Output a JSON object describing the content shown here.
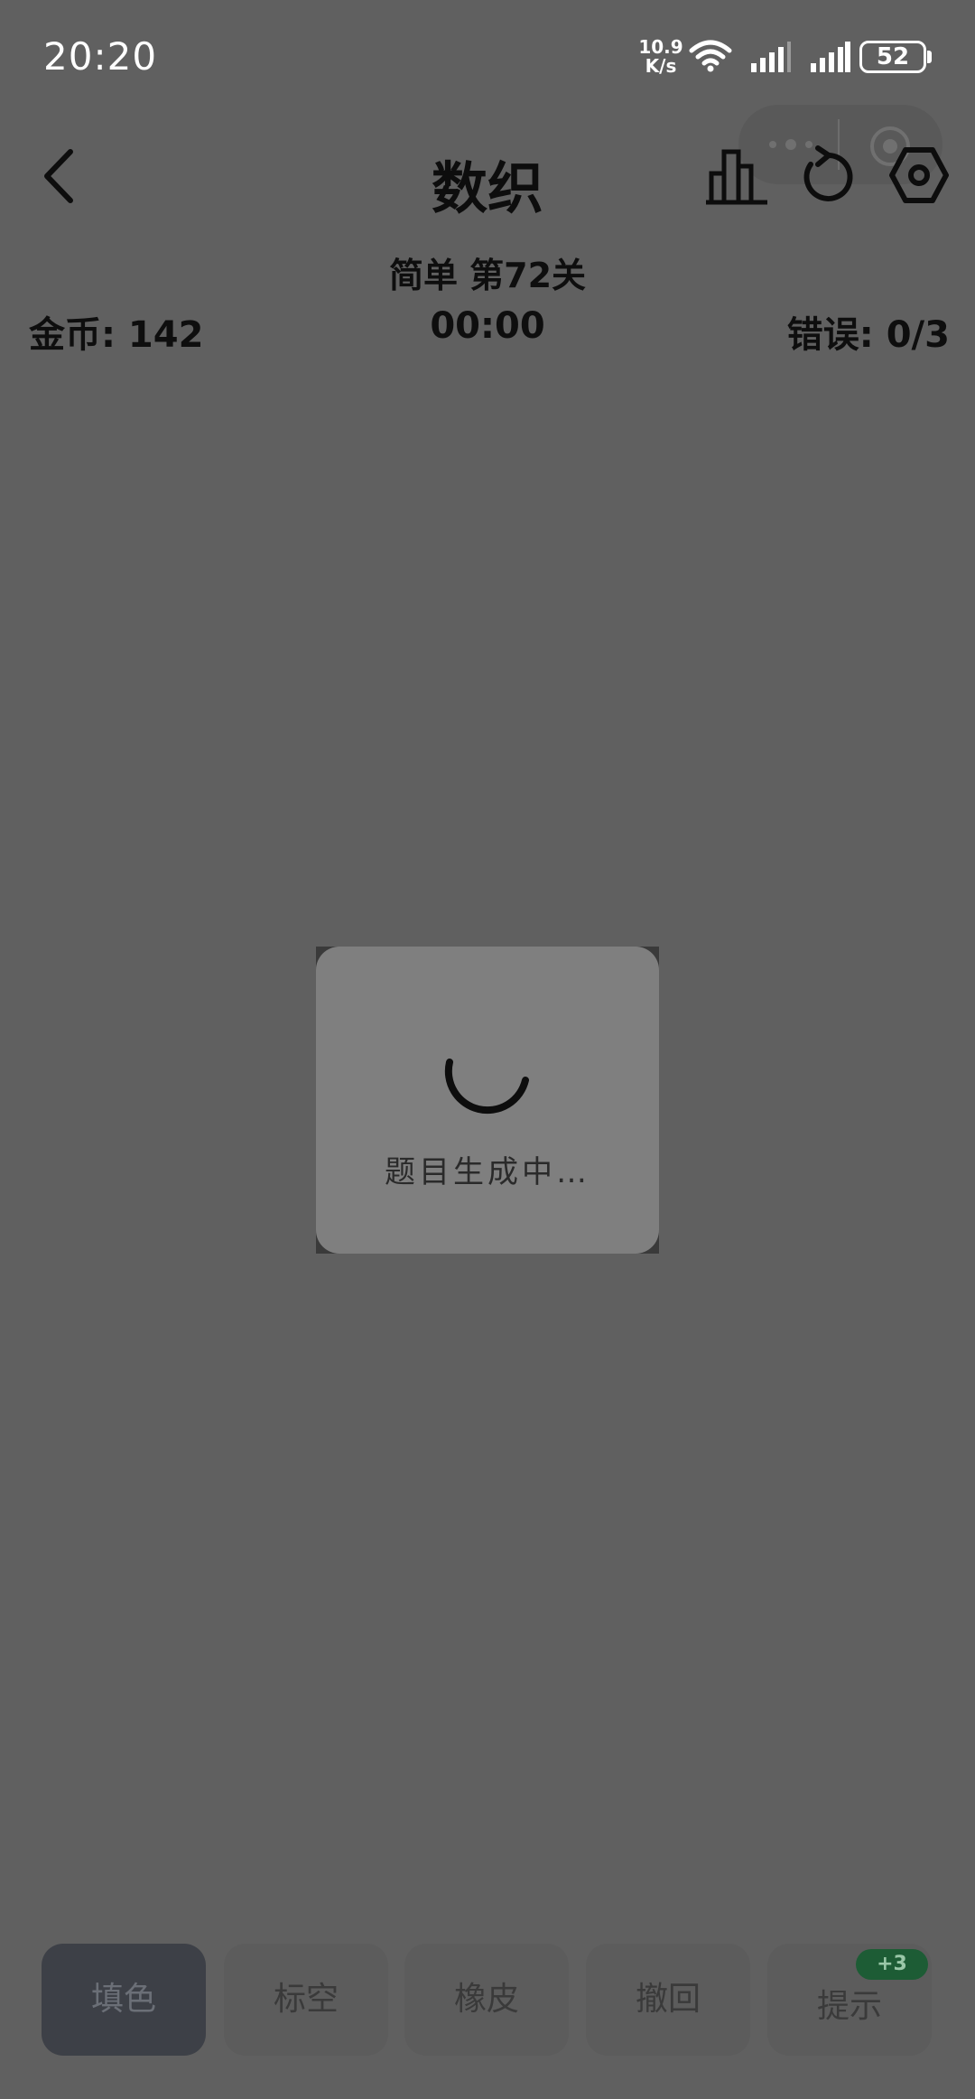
{
  "status_bar": {
    "time": "20:20",
    "net_speed_value": "10.9",
    "net_speed_unit": "K/s",
    "battery": "52"
  },
  "header": {
    "title": "数织",
    "level": "简单 第72关",
    "coins": "金币: 142",
    "timer": "00:00",
    "errors": "错误: 0/3"
  },
  "loading": {
    "text": "题目生成中…"
  },
  "toolbar": {
    "fill": "填色",
    "mark_empty": "标空",
    "eraser": "橡皮",
    "undo": "撤回",
    "hint": "提示",
    "hint_badge": "+3"
  },
  "colors": {
    "background": "#606060",
    "dialog": "#7f7f7f",
    "active_tool": "#3d4047",
    "badge": "#1d5c35"
  }
}
